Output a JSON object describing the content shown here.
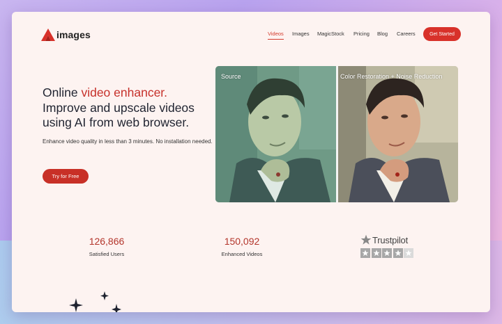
{
  "brand": {
    "name": "images",
    "color": "#d8312a"
  },
  "nav": {
    "items": [
      {
        "label": "Videos",
        "active": true
      },
      {
        "label": "Images",
        "active": false
      },
      {
        "label": "MagicStock",
        "active": false
      },
      {
        "label": "Pricing",
        "active": false
      },
      {
        "label": "Blog",
        "active": false
      },
      {
        "label": "Careers",
        "active": false
      }
    ],
    "cta": "Get Started"
  },
  "hero": {
    "title_prefix": "Online ",
    "title_accent": "video enhancer.",
    "title_rest": "Improve and upscale videos using AI from web browser.",
    "description": "Enhance video quality in less than 3 minutes. No installation needed.",
    "cta": "Try for Free"
  },
  "comparison": {
    "left_label": "Source",
    "right_label": "Color Restoration + Noise Reduction"
  },
  "stats": [
    {
      "value": "126,866",
      "label": "Satisfied Users"
    },
    {
      "value": "150,092",
      "label": "Enhanced Videos"
    }
  ],
  "trustpilot": {
    "name": "Trustpilot",
    "rating": 4,
    "max": 5
  }
}
